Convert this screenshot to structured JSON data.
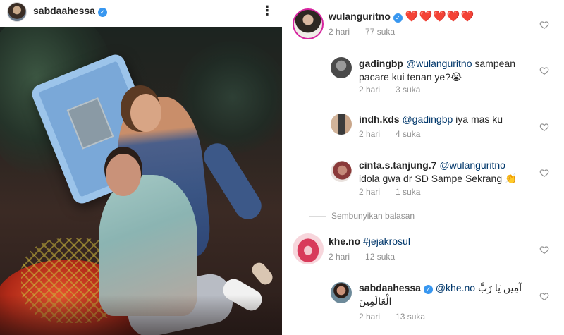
{
  "post": {
    "author": "sabdaahessa",
    "more_icon": "more-vertical-icon"
  },
  "comments": {
    "c1": {
      "username": "wulanguritno",
      "text": "❤️❤️❤️❤️❤️",
      "time": "2 hari",
      "likes": "77 suka"
    },
    "r1": {
      "username": "gadingbp",
      "mention": "@wulanguritno",
      "text_line1": " sampean",
      "text_line2": "pacare kui tenan ye?😭",
      "time": "2 hari",
      "likes": "3 suka"
    },
    "r2": {
      "username": "indh.kds",
      "mention": "@gadingbp",
      "text": " iya mas ku",
      "time": "2 hari",
      "likes": "4 suka"
    },
    "r3": {
      "username": "cinta.s.tanjung.7",
      "mention": "@wulanguritno",
      "text_line2": "idola gwa dr SD Sampe Sekrang 👏",
      "time": "2 hari",
      "likes": "1 suka"
    },
    "hide_replies": "Sembunyikan balasan",
    "c2": {
      "username": "khe.no",
      "hashtag": "#jejakrosul",
      "time": "2 hari",
      "likes": "12 suka"
    },
    "r4": {
      "username": "sabdaahessa",
      "mention": "@khe.no",
      "arabic1": "آمِين يَا رَبَّ",
      "arabic2": "الْعَالَمِينَ",
      "time": "2 hari",
      "likes": "13 suka"
    }
  },
  "colors": {
    "text": "#262626",
    "meta": "#8e8e8e",
    "link": "#00376b",
    "verified": "#3897f0",
    "heart_red": "#ed1c24"
  }
}
